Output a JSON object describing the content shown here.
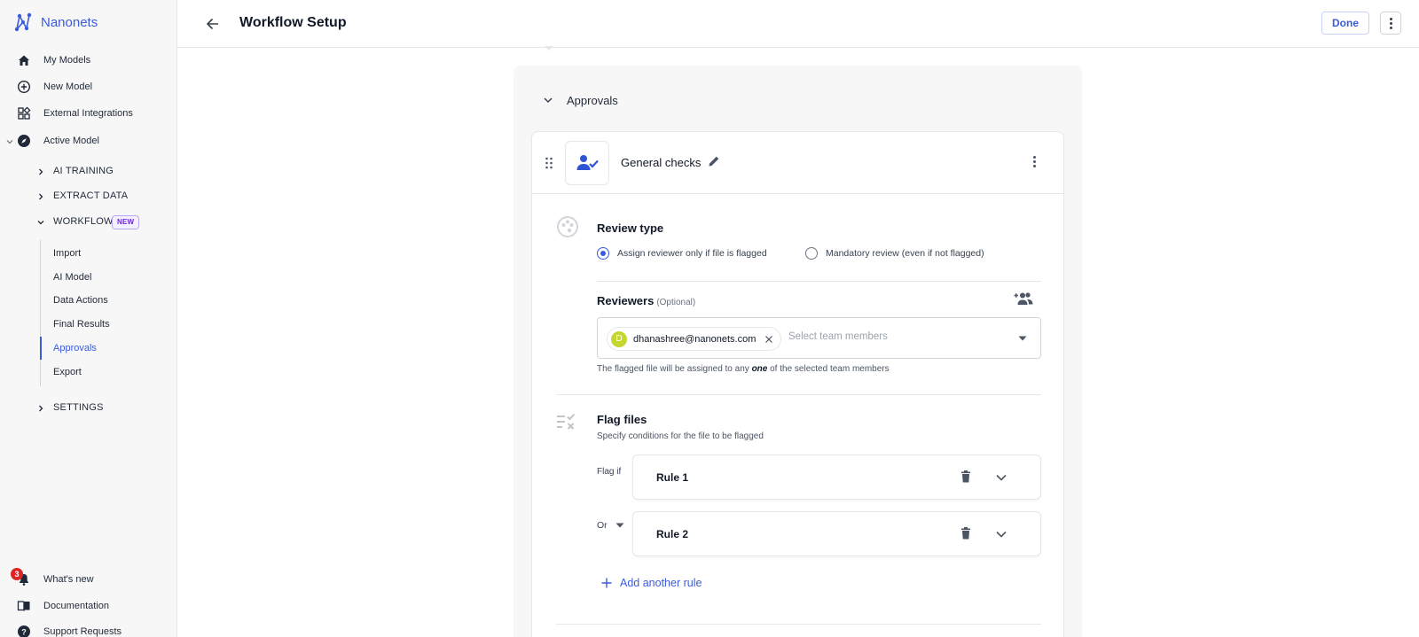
{
  "brand": {
    "name": "Nanonets"
  },
  "sidebar": {
    "items": [
      {
        "label": "My Models"
      },
      {
        "label": "New Model"
      },
      {
        "label": "External Integrations"
      },
      {
        "label": "Active Model"
      }
    ],
    "sections": [
      {
        "label": "AI TRAINING"
      },
      {
        "label": "EXTRACT DATA"
      },
      {
        "label": "WORKFLOW",
        "badge": "NEW"
      },
      {
        "label": "SETTINGS"
      }
    ],
    "workflow_steps": [
      {
        "label": "Import"
      },
      {
        "label": "AI Model"
      },
      {
        "label": "Data Actions"
      },
      {
        "label": "Final Results"
      },
      {
        "label": "Approvals"
      },
      {
        "label": "Export"
      }
    ],
    "footer": [
      {
        "label": "What's new",
        "count": "3"
      },
      {
        "label": "Documentation"
      },
      {
        "label": "Support Requests"
      }
    ]
  },
  "header": {
    "title": "Workflow Setup",
    "done_label": "Done"
  },
  "section": {
    "title": "Approvals"
  },
  "card": {
    "name": "General checks",
    "review_type": {
      "title": "Review type",
      "options": [
        {
          "label": "Assign reviewer only if file is flagged",
          "selected": true
        },
        {
          "label": "Mandatory review (even if not flagged)",
          "selected": false
        }
      ]
    },
    "reviewers": {
      "title": "Reviewers",
      "optional": "(Optional)",
      "chip": {
        "initial": "D",
        "email": "dhanashree@nanonets.com"
      },
      "placeholder": "Select team members",
      "helper_before": "The flagged file will be assigned to any ",
      "helper_em": "one",
      "helper_after": " of the selected team members"
    },
    "flag_files": {
      "title": "Flag files",
      "subtitle": "Specify conditions for the file to be flagged",
      "flag_if_label": "Flag if",
      "or_label": "Or",
      "rules": [
        {
          "label": "Rule 1"
        },
        {
          "label": "Rule 2"
        }
      ],
      "add_rule_label": "Add another rule"
    }
  },
  "colors": {
    "accent": "#3b5bdb",
    "avatar": "#c6d630",
    "notification": "#dc2626"
  }
}
